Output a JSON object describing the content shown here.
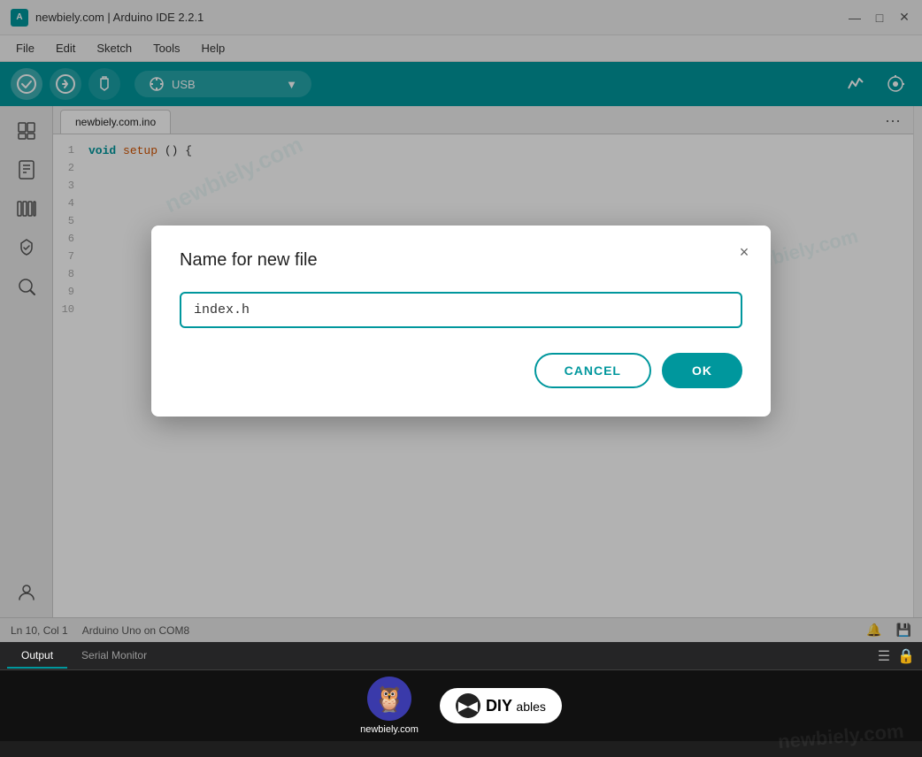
{
  "titleBar": {
    "title": "newbiely.com | Arduino IDE 2.2.1",
    "iconLabel": "A"
  },
  "menuBar": {
    "items": [
      "File",
      "Edit",
      "Sketch",
      "Tools",
      "Help"
    ]
  },
  "toolbar": {
    "verifyLabel": "✓",
    "uploadLabel": "→",
    "debugLabel": "▷",
    "boardIcon": "⌀",
    "boardName": "",
    "serialMonitorIcon": "⚡",
    "settingsIcon": "⊙"
  },
  "sidebar": {
    "icons": [
      "📁",
      "📋",
      "📚",
      "◁"
    ]
  },
  "editor": {
    "tab": "newbiely.com.ino",
    "lines": [
      {
        "num": "1",
        "code": "void setup() {"
      },
      {
        "num": "2",
        "code": ""
      },
      {
        "num": "3",
        "code": ""
      },
      {
        "num": "4",
        "code": ""
      },
      {
        "num": "5",
        "code": ""
      },
      {
        "num": "6",
        "code": ""
      },
      {
        "num": "7",
        "code": ""
      },
      {
        "num": "8",
        "code": ""
      },
      {
        "num": "9",
        "code": ""
      },
      {
        "num": "10",
        "code": ""
      }
    ],
    "watermarkLines": [
      "newbiely.com",
      "newbiely.com",
      "newbiely.com"
    ]
  },
  "statusBar": {
    "position": "Ln 10, Col 1",
    "board": "Arduino Uno on COM8",
    "bellIcon": "🔔",
    "diskIcon": "💾"
  },
  "bottomPanel": {
    "tabs": [
      "Output",
      "Serial Monitor"
    ],
    "activeTab": "Output",
    "watermark": "newbiely.com"
  },
  "dialog": {
    "title": "Name for new file",
    "inputValue": "index.h",
    "cancelLabel": "CANCEL",
    "okLabel": "OK",
    "closeIcon": "×"
  },
  "sponsor": {
    "newbielyText": "newbiely.com",
    "diyText": "DIY",
    "ablesText": "ables"
  },
  "colors": {
    "teal": "#00979d",
    "darkTeal": "#007f85"
  }
}
